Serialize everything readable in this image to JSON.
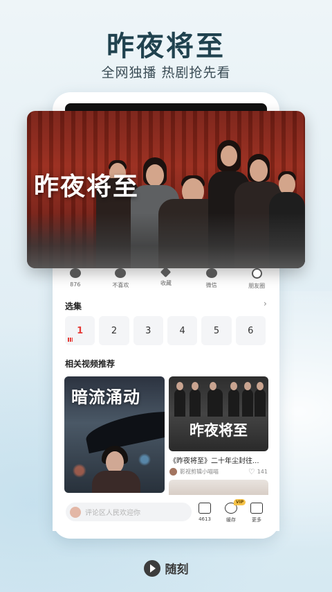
{
  "promo": {
    "title": "昨夜将至",
    "subtitle": "全网独播 热剧抢先看"
  },
  "hero": {
    "title": "昨夜将至"
  },
  "actions": [
    {
      "icon": "like-icon",
      "label": "876"
    },
    {
      "icon": "dislike-icon",
      "label": "不喜欢"
    },
    {
      "icon": "star-icon",
      "label": "收藏"
    },
    {
      "icon": "wechat-icon",
      "label": "微信"
    },
    {
      "icon": "moments-icon",
      "label": "朋友圈"
    }
  ],
  "episodes": {
    "header": "选集",
    "items": [
      "1",
      "2",
      "3",
      "4",
      "5",
      "6"
    ],
    "active": "1"
  },
  "recommend": {
    "header": "相关视频推荐",
    "left_card": {
      "title": "暗流涌动"
    },
    "right_card": {
      "title": "昨夜将至",
      "caption": "《昨夜将至》二十年尘封往...",
      "author": "影视剪辑小喵喵",
      "likes": "141"
    }
  },
  "bottom_bar": {
    "comment_placeholder": "评论区人民欢迎你",
    "comment_count": "4613",
    "cache_label": "缓存",
    "vip_badge": "VIP",
    "more_label": "更多"
  },
  "brand": {
    "name": "随刻"
  },
  "colors": {
    "accent": "#e53935",
    "headline": "#20424f",
    "vip": "#f5c248"
  }
}
